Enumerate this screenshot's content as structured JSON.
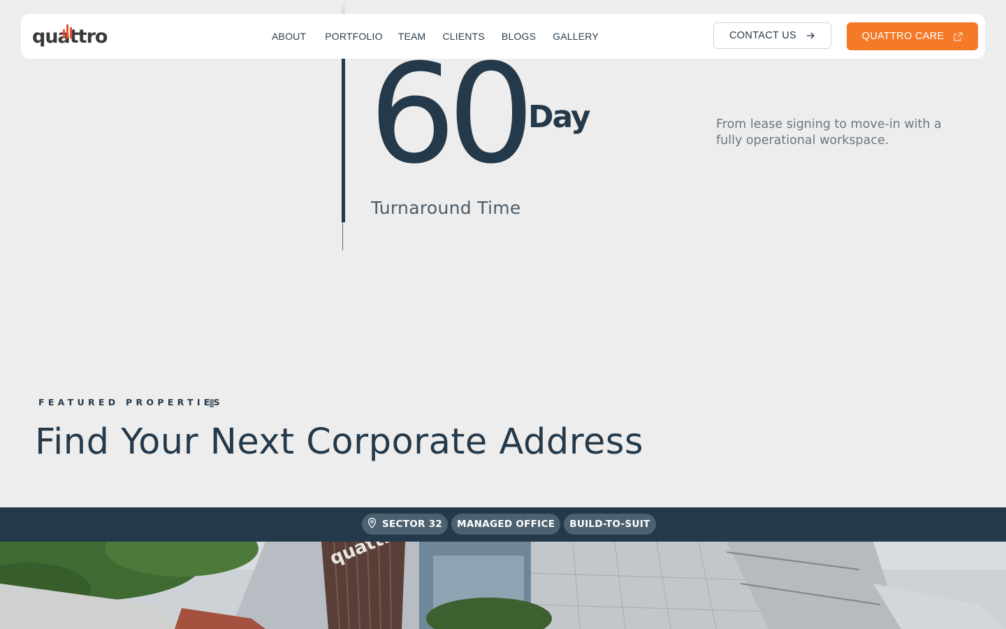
{
  "header": {
    "logo_text": "quattro",
    "nav": [
      "ABOUT",
      "PORTFOLIO",
      "TEAM",
      "CLIENTS",
      "BLOGS",
      "GALLERY"
    ],
    "contact_label": "CONTACT US",
    "care_label": "QUATTRO CARE"
  },
  "stat": {
    "number": "60",
    "unit": "Day",
    "label": "Turnaround Time",
    "description": "From lease signing to move-in with a fully operational workspace."
  },
  "featured": {
    "eyebrow": "FEATURED PROPERTIES",
    "heading": "Find Your Next Corporate Address"
  },
  "property": {
    "tags": [
      "SECTOR 32",
      "MANAGED OFFICE",
      "BUILD-TO-SUIT"
    ],
    "photo_sign": "quattro"
  },
  "colors": {
    "navy": "#24394a",
    "accent_orange": "#f47a28",
    "logo_red": "#e8532e",
    "background": "#ededed"
  },
  "icons": [
    "arrow-right-icon",
    "external-link-icon",
    "map-pin-icon"
  ]
}
